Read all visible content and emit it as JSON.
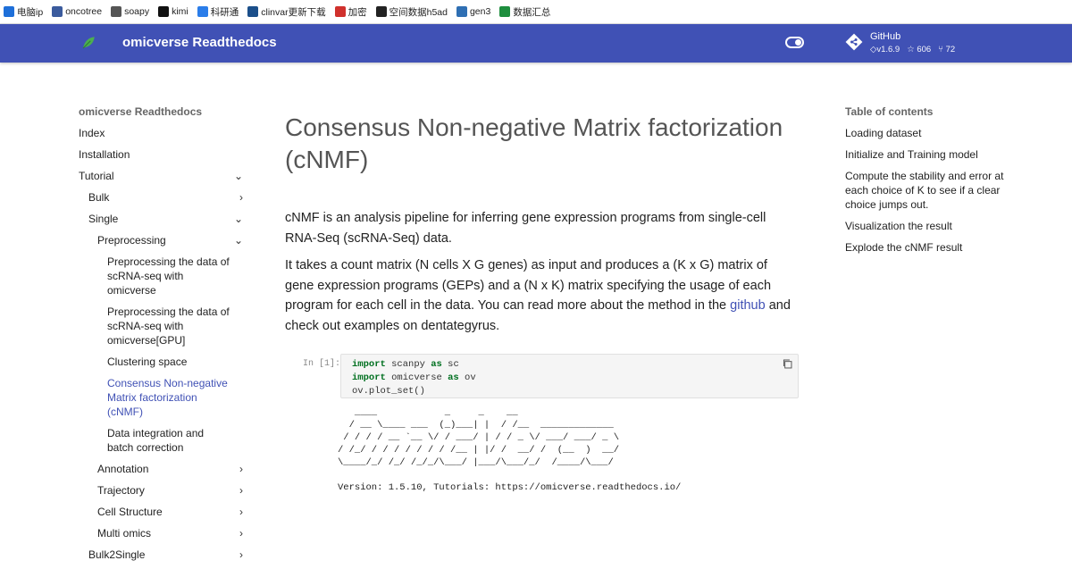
{
  "bookmarks": [
    {
      "label": "电脑ip",
      "icon": "ip-icon",
      "color": "#1e6fd9"
    },
    {
      "label": "oncotree",
      "icon": "oncotree-icon",
      "color": "#3b5b9d"
    },
    {
      "label": "soapy",
      "icon": "soapy-icon",
      "color": "#555555"
    },
    {
      "label": "kimi",
      "icon": "kimi-icon",
      "color": "#111111"
    },
    {
      "label": "科研通",
      "icon": "keyantong-icon",
      "color": "#2b7de9"
    },
    {
      "label": "clinvar更新下载",
      "icon": "clinvar-icon",
      "color": "#1b4f8a"
    },
    {
      "label": "加密",
      "icon": "encrypt-icon",
      "color": "#d0312d"
    },
    {
      "label": "空间数据h5ad",
      "icon": "spatial-icon",
      "color": "#222222"
    },
    {
      "label": "gen3",
      "icon": "gen3-icon",
      "color": "#2f6fb3"
    },
    {
      "label": "数据汇总",
      "icon": "sheet-icon",
      "color": "#1e8e3e"
    }
  ],
  "header": {
    "title": "omicverse Readthedocs",
    "bg_color": "#4051b5",
    "repo": {
      "name": "GitHub",
      "version": "v1.6.9",
      "stars": "606",
      "forks": "72"
    }
  },
  "nav": {
    "title": "omicverse Readthedocs",
    "items": [
      {
        "label": "Index",
        "level": 1,
        "chevron": ""
      },
      {
        "label": "Installation",
        "level": 1,
        "chevron": ""
      },
      {
        "label": "Tutorial",
        "level": 1,
        "chevron": "⌄"
      },
      {
        "label": "Bulk",
        "level": 2,
        "chevron": "›"
      },
      {
        "label": "Single",
        "level": 2,
        "chevron": "⌄"
      },
      {
        "label": "Preprocessing",
        "level": 3,
        "chevron": "⌄"
      },
      {
        "label": "Preprocessing the data of scRNA-seq with omicverse",
        "level": 4,
        "chevron": ""
      },
      {
        "label": "Preprocessing the data of scRNA-seq with omicverse[GPU]",
        "level": 4,
        "chevron": ""
      },
      {
        "label": "Clustering space",
        "level": 4,
        "chevron": ""
      },
      {
        "label": "Consensus Non-negative Matrix factorization (cNMF)",
        "level": 4,
        "chevron": "",
        "active": true
      },
      {
        "label": "Data integration and batch correction",
        "level": 4,
        "chevron": ""
      },
      {
        "label": "Annotation",
        "level": 3,
        "chevron": "›"
      },
      {
        "label": "Trajectory",
        "level": 3,
        "chevron": "›"
      },
      {
        "label": "Cell Structure",
        "level": 3,
        "chevron": "›"
      },
      {
        "label": "Multi omics",
        "level": 3,
        "chevron": "›"
      },
      {
        "label": "Bulk2Single",
        "level": 2,
        "chevron": "›"
      }
    ]
  },
  "main": {
    "title": "Consensus Non-negative Matrix factorization (cNMF)",
    "para1": "cNMF is an analysis pipeline for inferring gene expression programs from single-cell RNA-Seq (scRNA-Seq) data.",
    "para2_pre": "It takes a count matrix (N cells X G genes) as input and produces a (K x G) matrix of gene expression programs (GEPs) and a (N x K) matrix specifying the usage of each program for each cell in the data. You can read more about the method in the ",
    "para2_link": "github",
    "para2_post": " and check out examples on dentategyrus.",
    "cell": {
      "prompt": "In [1]:",
      "lines": [
        {
          "kw": "import",
          "rest": " scanpy ",
          "kw2": "as",
          "rest2": " sc"
        },
        {
          "kw": "import",
          "rest": " omicverse ",
          "kw2": "as",
          "rest2": " ov"
        },
        {
          "kw": "",
          "rest": "ov.plot_set()",
          "kw2": "",
          "rest2": ""
        }
      ]
    },
    "ascii_art": "   ____            _     _    __\n  / __ \\____ ___  (_)___| |  / /__  _____________\n / / / / __ `__ \\/ / ___/ | / / _ \\/ ___/ ___/ _ \\\n/ /_/ / / / / / / / /__ | |/ /  __/ /  (__  )  __/\n\\____/_/ /_/ /_/_/\\___/ |___/\\___/_/  /____/\\___/",
    "version": "Version: 1.5.10, Tutorials: https://omicverse.readthedocs.io/"
  },
  "toc": {
    "title": "Table of contents",
    "items": [
      "Loading dataset",
      "Initialize and Training model",
      "Compute the stability and error at each choice of K to see if a clear choice jumps out.",
      "Visualization the result",
      "Explode the cNMF result"
    ]
  }
}
